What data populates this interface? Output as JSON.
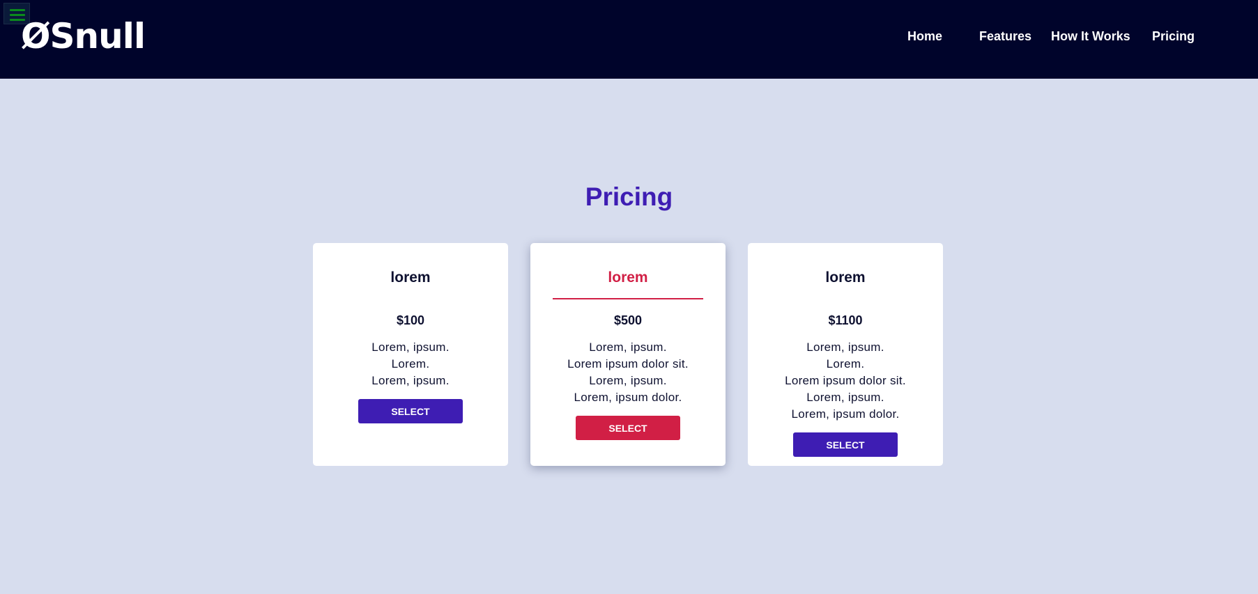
{
  "header": {
    "logo": "ØSnull",
    "menu_icon": "hamburger-menu-icon",
    "nav": [
      {
        "label": "Home"
      },
      {
        "label": "Features"
      },
      {
        "label": "How It Works"
      },
      {
        "label": "Pricing"
      }
    ]
  },
  "pricing": {
    "title": "Pricing",
    "plans": [
      {
        "name": "lorem",
        "price": "$100",
        "features": [
          "Lorem, ipsum.",
          "Lorem.",
          "Lorem, ipsum."
        ],
        "button": "SELECT",
        "featured": false
      },
      {
        "name": "lorem",
        "price": "$500",
        "features": [
          "Lorem, ipsum.",
          "Lorem ipsum dolor sit.",
          "Lorem, ipsum.",
          "Lorem, ipsum dolor."
        ],
        "button": "SELECT",
        "featured": true
      },
      {
        "name": "lorem",
        "price": "$1100",
        "features": [
          "Lorem, ipsum.",
          "Lorem.",
          "Lorem ipsum dolor sit.",
          "Lorem, ipsum.",
          "Lorem, ipsum dolor."
        ],
        "button": "SELECT",
        "featured": false
      }
    ]
  },
  "colors": {
    "header_bg": "#00042b",
    "page_bg": "#d7ddee",
    "primary": "#3e1db3",
    "accent": "#d11f45",
    "menu_icon": "#0b8a1c"
  }
}
